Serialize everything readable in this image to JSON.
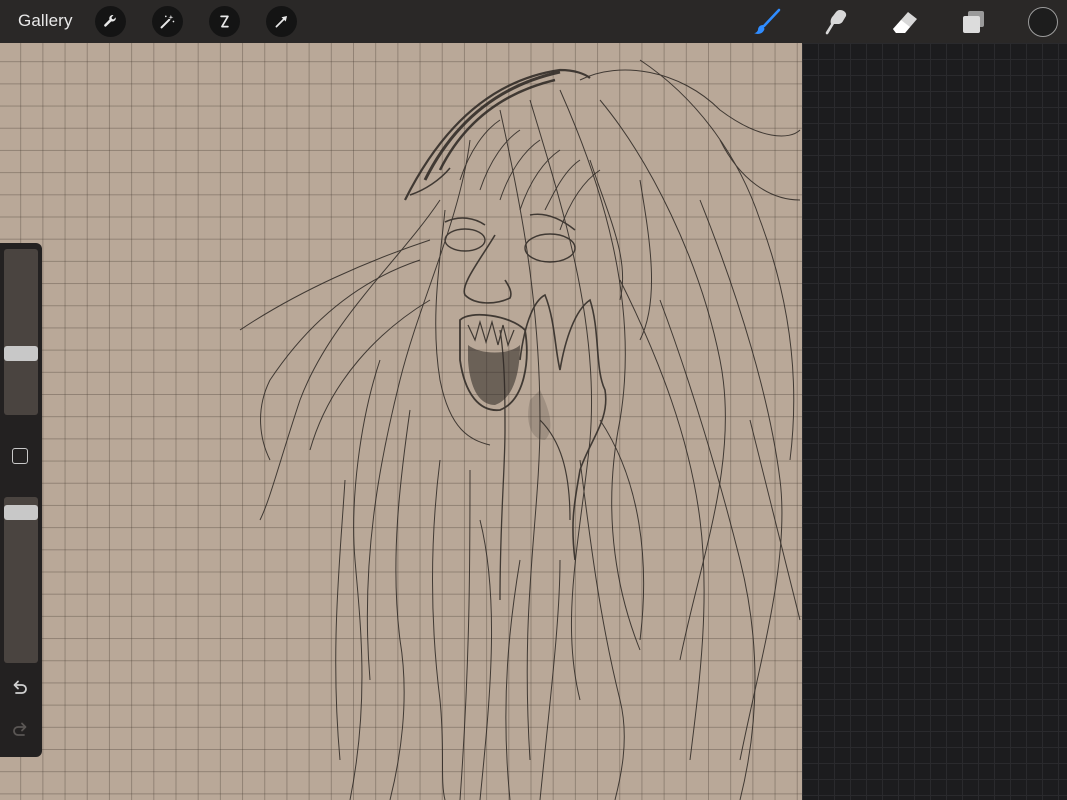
{
  "header": {
    "gallery_label": "Gallery",
    "tools_left": [
      {
        "name": "actions",
        "icon": "wrench-icon"
      },
      {
        "name": "adjustments",
        "icon": "magic-wand-icon"
      },
      {
        "name": "selection",
        "icon": "selection-s-icon"
      },
      {
        "name": "transform",
        "icon": "arrow-cursor-icon"
      }
    ],
    "tools_right": [
      {
        "name": "brush",
        "icon": "brush-icon",
        "active": true
      },
      {
        "name": "smudge",
        "icon": "smudge-finger-icon"
      },
      {
        "name": "eraser",
        "icon": "eraser-icon"
      },
      {
        "name": "layers",
        "icon": "layers-icon"
      }
    ],
    "active_color": "#1d1d1d",
    "accent_color": "#2f8cff"
  },
  "sidebar": {
    "brush_size_level": 0.36,
    "opacity_level": 0.95,
    "modify_button": "square-icon",
    "undo": "undo-icon",
    "redo": "redo-icon"
  },
  "canvas": {
    "paper_color": "#b9a898",
    "background_color": "#1c1c1e"
  }
}
